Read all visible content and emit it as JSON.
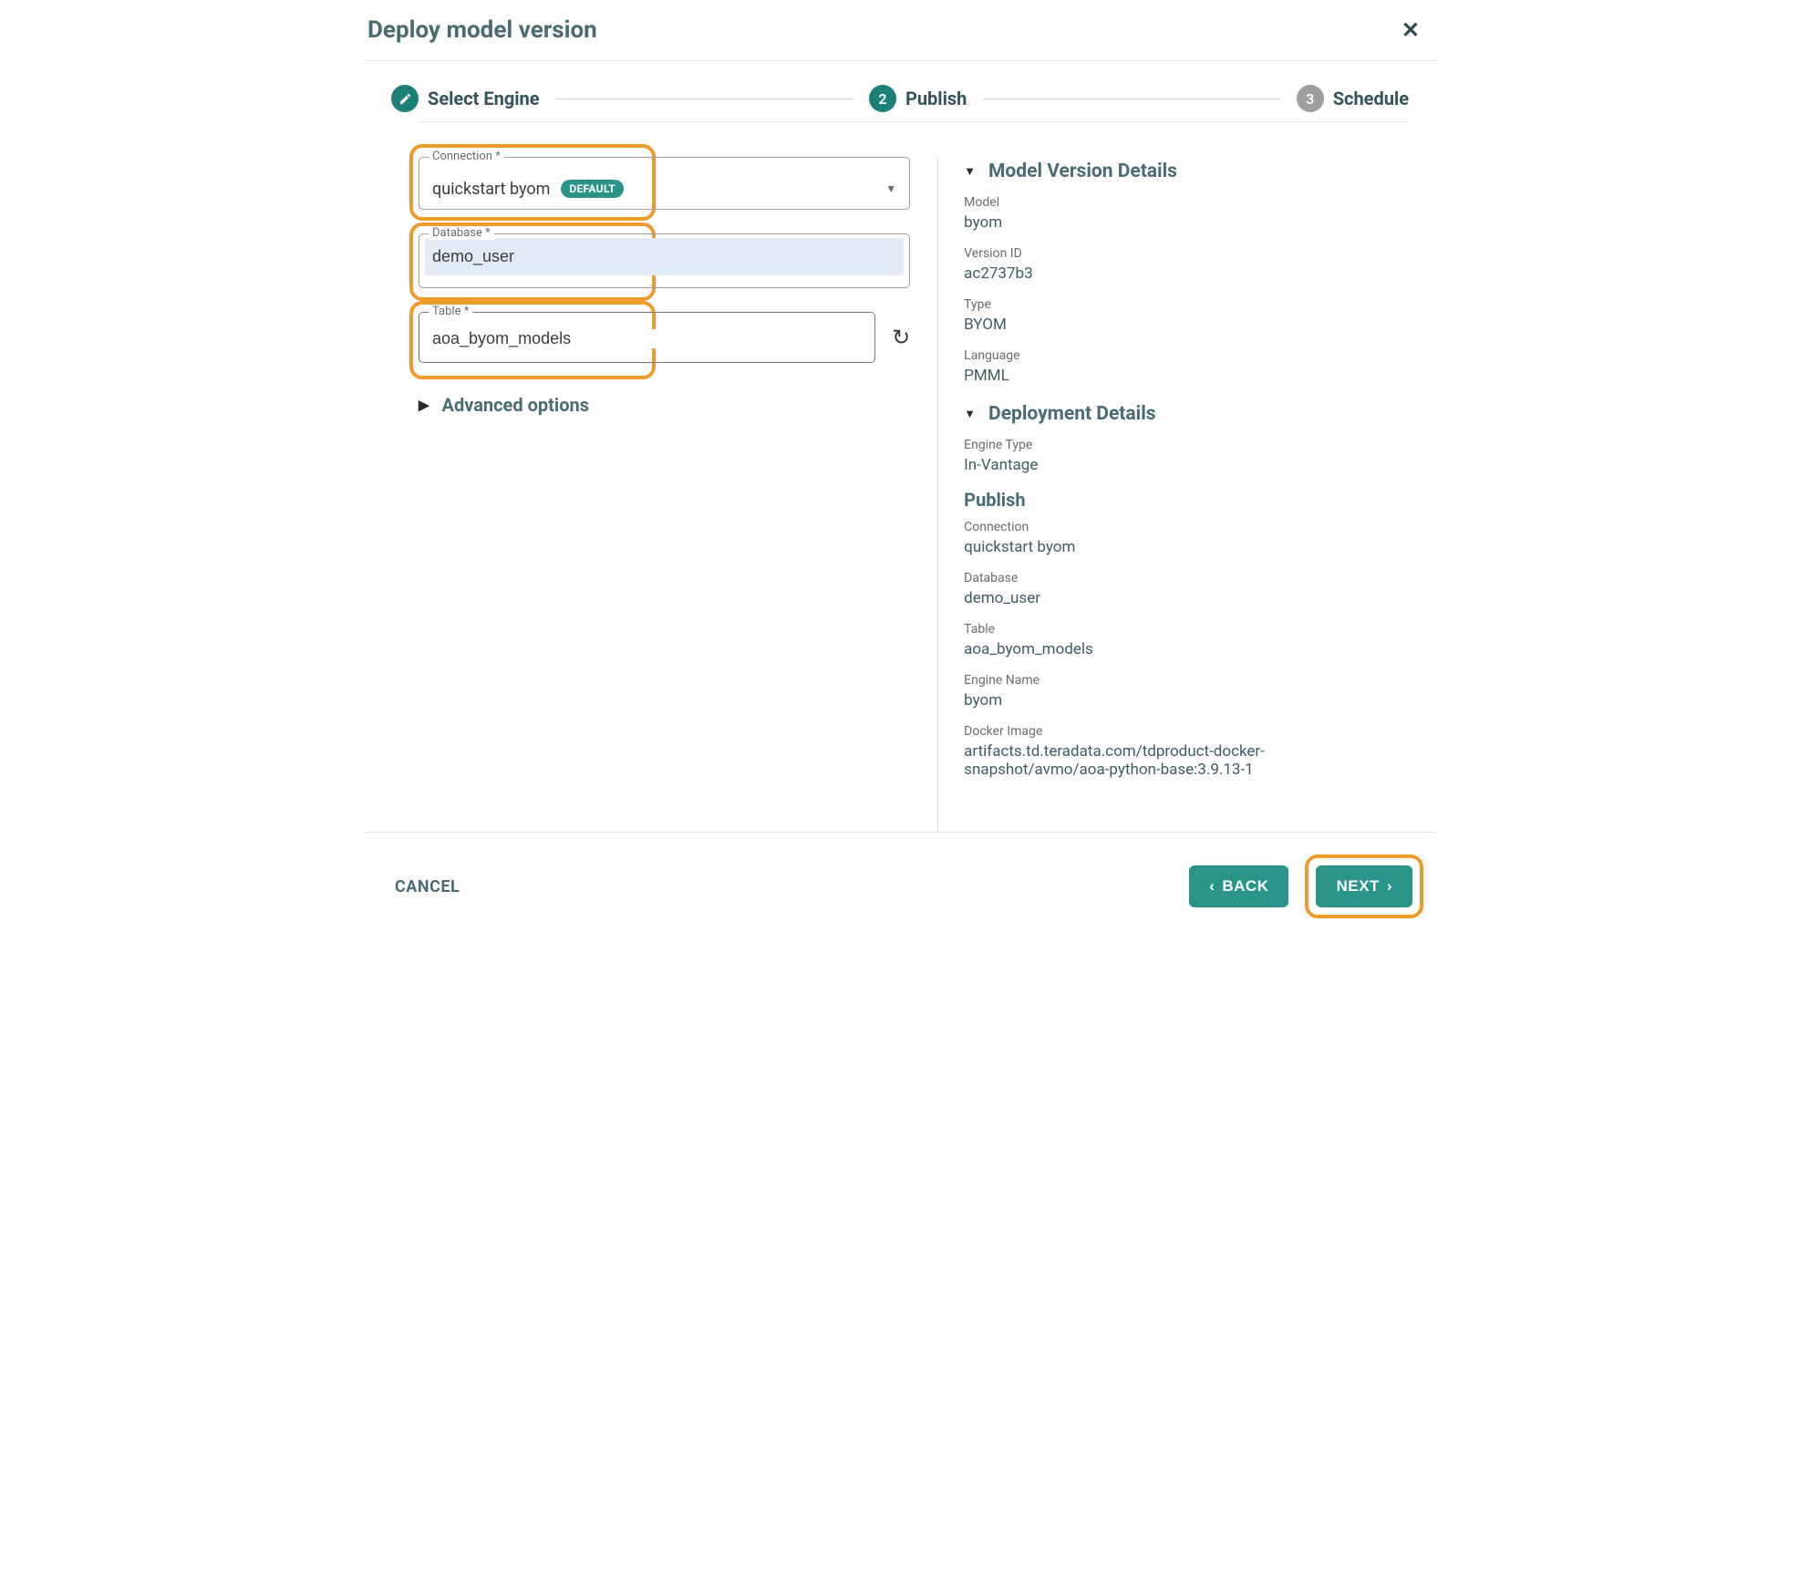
{
  "header": {
    "title": "Deploy model version"
  },
  "stepper": {
    "step1": {
      "label": "Select Engine"
    },
    "step2": {
      "num": "2",
      "label": "Publish"
    },
    "step3": {
      "num": "3",
      "label": "Schedule"
    }
  },
  "form": {
    "connection": {
      "label": "Connection *",
      "value": "quickstart byom",
      "badge": "DEFAULT"
    },
    "database": {
      "label": "Database *",
      "value": "demo_user"
    },
    "table": {
      "label": "Table *",
      "value": "aoa_byom_models"
    },
    "advanced": "Advanced options"
  },
  "details": {
    "model_version": {
      "title": "Model Version Details",
      "model_label": "Model",
      "model_value": "byom",
      "version_label": "Version ID",
      "version_value": "ac2737b3",
      "type_label": "Type",
      "type_value": "BYOM",
      "lang_label": "Language",
      "lang_value": "PMML"
    },
    "deployment": {
      "title": "Deployment Details",
      "engine_type_label": "Engine Type",
      "engine_type_value": "In-Vantage",
      "publish_head": "Publish",
      "conn_label": "Connection",
      "conn_value": "quickstart byom",
      "db_label": "Database",
      "db_value": "demo_user",
      "table_label": "Table",
      "table_value": "aoa_byom_models",
      "engine_name_label": "Engine Name",
      "engine_name_value": "byom",
      "docker_label": "Docker Image",
      "docker_value": "artifacts.td.teradata.com/tdproduct-docker-snapshot/avmo/aoa-python-base:3.9.13-1"
    }
  },
  "footer": {
    "cancel": "CANCEL",
    "back": "BACK",
    "next": "NEXT"
  }
}
